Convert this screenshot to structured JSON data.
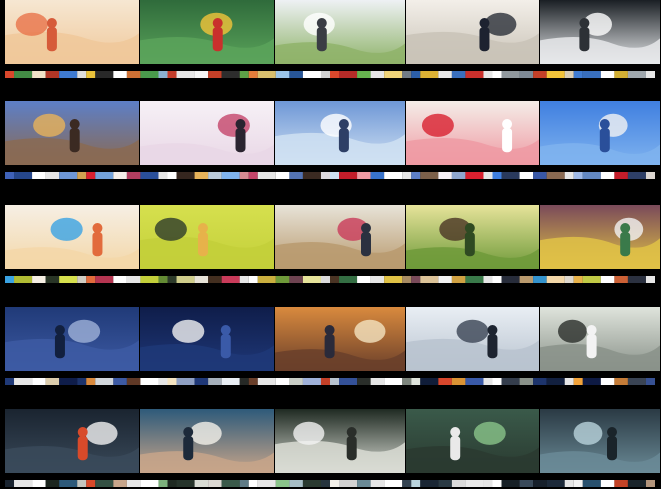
{
  "sheet": {
    "rows": [
      {
        "frames": [
          {
            "sky": "#f6e7d2",
            "ground": "#f0c89a",
            "accent": "#e8734a",
            "figure": "#d65b3a"
          },
          {
            "sky": "#2f6b3b",
            "ground": "#5aa35a",
            "accent": "#f3c43a",
            "figure": "#c9302c"
          },
          {
            "sky": "#eef1f4",
            "ground": "#8fb36a",
            "accent": "#ffffff",
            "figure": "#3a3d44"
          },
          {
            "sky": "#f3efe9",
            "ground": "#c9c3b7",
            "accent": "#2b2f38",
            "figure": "#1d2230"
          },
          {
            "sky": "#1a1f24",
            "ground": "#e6e8ea",
            "accent": "#ffffff",
            "figure": "#2d3136"
          }
        ],
        "barcode": [
          "#d9472c",
          "#f1e3c8",
          "#3f7bd1",
          "#e9c23a",
          "#ffffff",
          "#4a9a4c",
          "#c33c2a",
          "#f5f5f5",
          "#2d2d2d",
          "#e37d3b",
          "#9bc4e8",
          "#ffffff",
          "#d9472c",
          "#67b34f",
          "#f0d47a",
          "#2c5fa8",
          "#e9e9e9",
          "#c9302c",
          "#ffffff",
          "#7e8a96",
          "#f3c43a",
          "#3f7bd1",
          "#ffffff",
          "#a0a8ae"
        ]
      },
      {
        "frames": [
          {
            "sky": "#5d7fc7",
            "ground": "#8a6a52",
            "accent": "#e8b35a",
            "figure": "#3b2a22"
          },
          {
            "sky": "#f6f1f6",
            "ground": "#e9d7e6",
            "accent": "#c4456a",
            "figure": "#2a2430"
          },
          {
            "sky": "#6e97d6",
            "ground": "#cfe0f2",
            "accent": "#ffffff",
            "figure": "#2e3f66"
          },
          {
            "sky": "#f4ede8",
            "ground": "#ef9aa3",
            "accent": "#d8202f",
            "figure": "#ffffff"
          },
          {
            "sky": "#3f7fe0",
            "ground": "#7fb3ef",
            "accent": "#f3f3f3",
            "figure": "#2a4f9a"
          }
        ],
        "barcode": [
          "#3f62b8",
          "#ffffff",
          "#6e97d6",
          "#d8202f",
          "#f4ede8",
          "#2a4f9a",
          "#ffffff",
          "#e8b35a",
          "#7fb3ef",
          "#c4456a",
          "#ffffff",
          "#3b2a22",
          "#cfe0f2",
          "#ef9aa3",
          "#ffffff",
          "#5d7fc7",
          "#f6f1f6",
          "#d8202f",
          "#3f7fe0",
          "#ffffff",
          "#8a6a52",
          "#9fb9e6",
          "#ffffff",
          "#2e3f66"
        ]
      },
      {
        "frames": [
          {
            "sky": "#f6efe4",
            "ground": "#f3d7a8",
            "accent": "#3aa3e3",
            "figure": "#e26b3c"
          },
          {
            "sky": "#d6e04e",
            "ground": "#c3cf3a",
            "accent": "#2d3b2a",
            "figure": "#e7b24a"
          },
          {
            "sky": "#e7e3d8",
            "ground": "#b99a6e",
            "accent": "#c93b5a",
            "figure": "#2b3140"
          },
          {
            "sky": "#e6e39a",
            "ground": "#6f9a3a",
            "accent": "#4a3424",
            "figure": "#2f4a22"
          },
          {
            "sky": "#7a4a5a",
            "ground": "#e0c246",
            "accent": "#f2f2f2",
            "figure": "#3a7a4a"
          }
        ],
        "barcode": [
          "#3aa3e3",
          "#f6efe4",
          "#d6e04e",
          "#e26b3c",
          "#ffffff",
          "#c3cf3a",
          "#2d3b2a",
          "#e7e3d8",
          "#c93b5a",
          "#ffffff",
          "#6f9a3a",
          "#e6e39a",
          "#4a3424",
          "#ffffff",
          "#e0c246",
          "#7a4a5a",
          "#f2f2f2",
          "#3a7a4a",
          "#ffffff",
          "#b99a6e",
          "#f3d7a8",
          "#e7b24a",
          "#ffffff",
          "#2b3140"
        ]
      },
      {
        "frames": [
          {
            "sky": "#203a78",
            "ground": "#3d5aa3",
            "accent": "#9fb1d8",
            "figure": "#12203f"
          },
          {
            "sky": "#0f1d4a",
            "ground": "#1f3878",
            "accent": "#f2f2f2",
            "figure": "#3a5aa8"
          },
          {
            "sky": "#d98a3e",
            "ground": "#6a3f2a",
            "accent": "#f4e3c0",
            "figure": "#2a2a3a"
          },
          {
            "sky": "#e9eef4",
            "ground": "#b8c3cf",
            "accent": "#3a4454",
            "figure": "#1d2430"
          },
          {
            "sky": "#dfe4dc",
            "ground": "#8a928a",
            "accent": "#2a2e2a",
            "figure": "#f3f3f3"
          }
        ],
        "barcode": [
          "#203a78",
          "#ffffff",
          "#0f1d4a",
          "#d98a3e",
          "#3d5aa3",
          "#ffffff",
          "#f4e3c0",
          "#1f3878",
          "#e9eef4",
          "#6a3f2a",
          "#ffffff",
          "#9fb1d8",
          "#b8c3cf",
          "#2a2e2a",
          "#ffffff",
          "#dfe4dc",
          "#d8472c",
          "#3a5aa8",
          "#ffffff",
          "#8a928a",
          "#12203f",
          "#f2a33a",
          "#ffffff",
          "#3a4454"
        ]
      },
      {
        "frames": [
          {
            "sky": "#1a2430",
            "ground": "#3a4a5a",
            "accent": "#f2f2f2",
            "figure": "#d84a2a"
          },
          {
            "sky": "#2e5a7a",
            "ground": "#c7a58a",
            "accent": "#f4f1ea",
            "figure": "#1d2a3a"
          },
          {
            "sky": "#1f2a22",
            "ground": "#d9dcd4",
            "accent": "#f2f2f2",
            "figure": "#2a2e2a"
          },
          {
            "sky": "#3a5a4a",
            "ground": "#2a3a30",
            "accent": "#8ac48a",
            "figure": "#e9e9e9"
          },
          {
            "sky": "#2a3a44",
            "ground": "#6a8a96",
            "accent": "#b9d3dc",
            "figure": "#1a242a"
          }
        ],
        "barcode": [
          "#1a2430",
          "#ffffff",
          "#2e5a7a",
          "#d84a2a",
          "#c7a58a",
          "#ffffff",
          "#1f2a22",
          "#d9dcd4",
          "#3a5a4a",
          "#ffffff",
          "#8ac48a",
          "#2a3a30",
          "#f4f1ea",
          "#6a8a96",
          "#ffffff",
          "#b9d3dc",
          "#2a3a44",
          "#e9e9e9",
          "#ffffff",
          "#3a4a5a",
          "#1d2a3a",
          "#f2f2f2",
          "#ffffff",
          "#1a242a"
        ]
      }
    ]
  }
}
